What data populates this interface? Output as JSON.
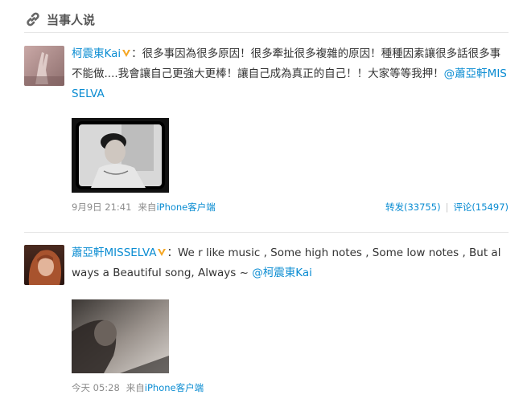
{
  "section": {
    "title": "当事人说",
    "icon": "link-icon"
  },
  "posts": [
    {
      "author": "柯震東Kai",
      "verified_badge": "v-badge-icon",
      "text": "：很多事因為很多原因！很多牽扯很多複雜的原因！種種因素讓很多話很多事不能做....我會讓自己更強大更棒！讓自己成為真正的自己！！大家等等我押！",
      "mention": "@蕭亞軒MISSELVA",
      "time": "9月9日 21:41",
      "from_label": "来自",
      "source": "iPhone客户端",
      "repost": "转发(33755)",
      "comment": "评论(15497)"
    },
    {
      "author": "蕭亞軒MISSELVA",
      "verified_badge": "v-badge-icon",
      "text": "：We r like music , Some high notes , Some low notes , But always a Beautiful song, Always ~ ",
      "mention": "@柯震東Kai",
      "time": "今天 05:28",
      "from_label": "来自",
      "source": "iPhone客户端"
    }
  ],
  "colors": {
    "link": "#0a8cd2",
    "meta": "#8c8c8c",
    "text": "#333333",
    "badge": "#f5a623"
  }
}
